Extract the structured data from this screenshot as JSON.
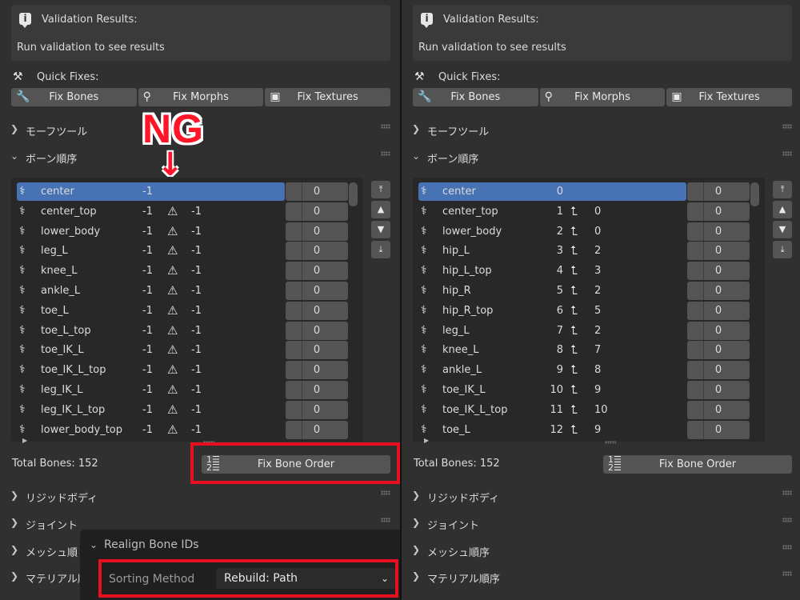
{
  "left": {
    "validation": {
      "title": "Validation Results:",
      "message": "Run validation to see results"
    },
    "quick_fixes": {
      "label": "Quick Fixes:",
      "buttons": [
        "Fix Bones",
        "Fix Morphs",
        "Fix Textures"
      ]
    },
    "sections": {
      "morph_tools": "モーフツール",
      "bone_order": "ボーン順序",
      "rigid_body": "リジッドボディ",
      "joint": "ジョイント",
      "mesh_order": "メッシュ順",
      "material_order": "マテリアル順"
    },
    "rows": [
      {
        "name": "center",
        "id": "-1",
        "parent": "",
        "value": "0",
        "warning": false,
        "selected": true
      },
      {
        "name": "center_top",
        "id": "-1",
        "parent": "-1",
        "value": "0",
        "warning": true
      },
      {
        "name": "lower_body",
        "id": "-1",
        "parent": "-1",
        "value": "0",
        "warning": true
      },
      {
        "name": "leg_L",
        "id": "-1",
        "parent": "-1",
        "value": "0",
        "warning": true
      },
      {
        "name": "knee_L",
        "id": "-1",
        "parent": "-1",
        "value": "0",
        "warning": true
      },
      {
        "name": "ankle_L",
        "id": "-1",
        "parent": "-1",
        "value": "0",
        "warning": true
      },
      {
        "name": "toe_L",
        "id": "-1",
        "parent": "-1",
        "value": "0",
        "warning": true
      },
      {
        "name": "toe_L_top",
        "id": "-1",
        "parent": "-1",
        "value": "0",
        "warning": true
      },
      {
        "name": "toe_IK_L",
        "id": "-1",
        "parent": "-1",
        "value": "0",
        "warning": true
      },
      {
        "name": "toe_IK_L_top",
        "id": "-1",
        "parent": "-1",
        "value": "0",
        "warning": true
      },
      {
        "name": "leg_IK_L",
        "id": "-1",
        "parent": "-1",
        "value": "0",
        "warning": true
      },
      {
        "name": "leg_IK_L_top",
        "id": "-1",
        "parent": "-1",
        "value": "0",
        "warning": true
      },
      {
        "name": "lower_body_top",
        "id": "-1",
        "parent": "-1",
        "value": "0",
        "warning": true
      }
    ],
    "total_bones": "Total Bones: 152",
    "fix_bone_order": "Fix Bone Order",
    "annotation": "NG",
    "annotation_arrow": "↓",
    "popup": {
      "title": "Realign Bone IDs",
      "label": "Sorting Method",
      "value": "Rebuild: Path"
    }
  },
  "right": {
    "validation": {
      "title": "Validation Results:",
      "message": "Run validation to see results"
    },
    "quick_fixes": {
      "label": "Quick Fixes:",
      "buttons": [
        "Fix Bones",
        "Fix Morphs",
        "Fix Textures"
      ]
    },
    "sections": {
      "morph_tools": "モーフツール",
      "bone_order": "ボーン順序",
      "rigid_body": "リジッドボディ",
      "joint": "ジョイント",
      "mesh_order": "メッシュ順序",
      "material_order": "マテリアル順序"
    },
    "rows": [
      {
        "name": "center",
        "id": "0",
        "parent": "",
        "value": "0",
        "selected": true
      },
      {
        "name": "center_top",
        "id": "1",
        "parent": "0",
        "value": "0"
      },
      {
        "name": "lower_body",
        "id": "2",
        "parent": "0",
        "value": "0"
      },
      {
        "name": "hip_L",
        "id": "3",
        "parent": "2",
        "value": "0"
      },
      {
        "name": "hip_L_top",
        "id": "4",
        "parent": "3",
        "value": "0"
      },
      {
        "name": "hip_R",
        "id": "5",
        "parent": "2",
        "value": "0"
      },
      {
        "name": "hip_R_top",
        "id": "6",
        "parent": "5",
        "value": "0"
      },
      {
        "name": "leg_L",
        "id": "7",
        "parent": "2",
        "value": "0"
      },
      {
        "name": "knee_L",
        "id": "8",
        "parent": "7",
        "value": "0"
      },
      {
        "name": "ankle_L",
        "id": "9",
        "parent": "8",
        "value": "0"
      },
      {
        "name": "toe_IK_L",
        "id": "10",
        "parent": "9",
        "value": "0"
      },
      {
        "name": "toe_IK_L_top",
        "id": "11",
        "parent": "10",
        "value": "0"
      },
      {
        "name": "toe_L",
        "id": "12",
        "parent": "9",
        "value": "0"
      }
    ],
    "total_bones": "Total Bones: 152",
    "fix_bone_order": "Fix Bone Order"
  },
  "icons": {
    "info": "info-icon",
    "tools": "screwdriver-wrench-icon",
    "wrench": "wrench-icon",
    "morph": "shape-key-icon",
    "texture": "image-icon",
    "bone": "bone-icon",
    "warning": "warning-icon",
    "parent": "parent-arrow-icon",
    "list-order": "numbered-list-icon"
  }
}
